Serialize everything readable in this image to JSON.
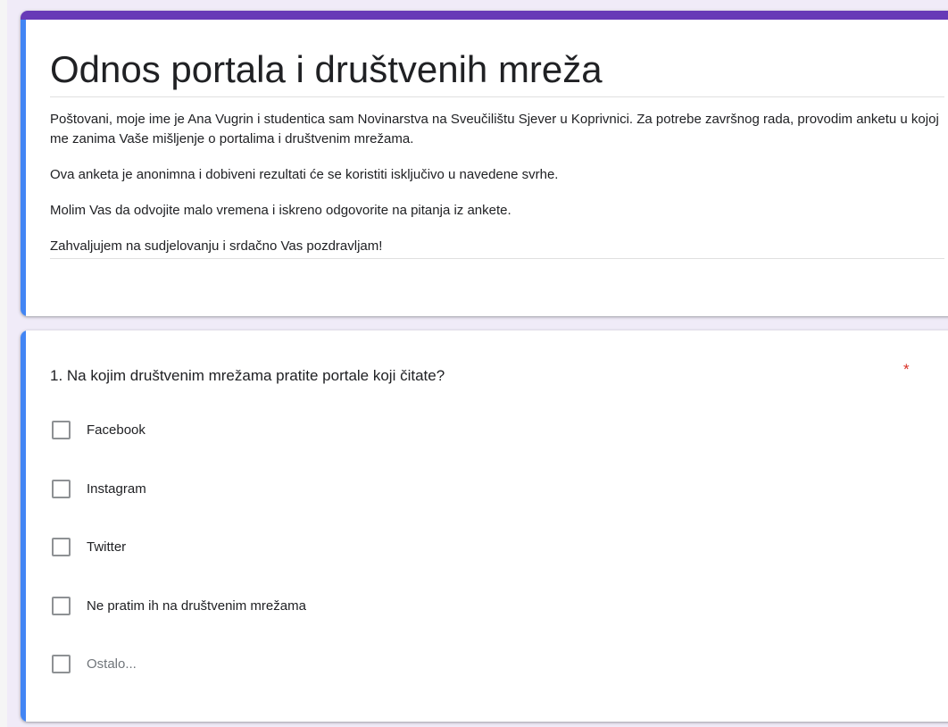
{
  "form": {
    "title": "Odnos portala i društvenih mreža",
    "description": [
      "Poštovani, moje ime je Ana Vugrin i studentica sam Novinarstva na Sveučilištu Sjever u Koprivnici. Za potrebe završnog rada, provodim anketu u kojoj me zanima Vaše mišljenje o portalima i društvenim mrežama.",
      "Ova anketa je anonimna i dobiveni rezultati će se koristiti isključivo u navedene svrhe.",
      "Molim Vas da odvojite malo vremena i iskreno odgovorite na pitanja iz ankete.",
      "Zahvaljujem na sudjelovanju i srdačno Vas pozdravljam!"
    ]
  },
  "question1": {
    "title": "1. Na kojim društvenim mrežama pratite portale koji čitate?",
    "required_marker": "*",
    "options": [
      {
        "label": "Facebook",
        "checked": false
      },
      {
        "label": "Instagram",
        "checked": false
      },
      {
        "label": "Twitter",
        "checked": false
      },
      {
        "label": "Ne pratim ih na društvenim mrežama",
        "checked": false
      },
      {
        "label": "Ostalo...",
        "checked": false
      }
    ]
  },
  "colors": {
    "theme_top_bar": "#673ab7",
    "active_accent": "#4285f4",
    "required": "#d93025",
    "background": "#f0ebf8"
  },
  "icons": {
    "checkbox": "checkbox-empty-icon"
  }
}
